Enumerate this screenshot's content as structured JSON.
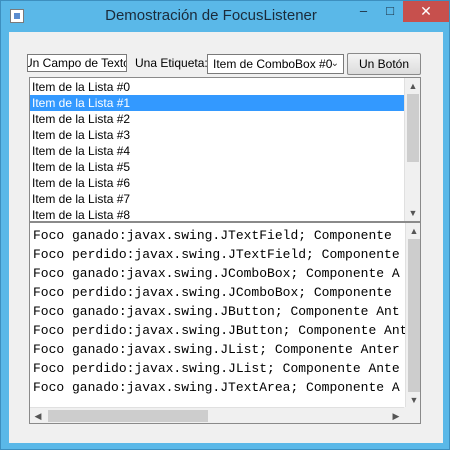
{
  "window": {
    "title": "Demostración de FocusListener",
    "controls": {
      "minimize": "–",
      "maximize": "□",
      "close": "✕"
    }
  },
  "top_row": {
    "textfield_value": "Un Campo de Texto",
    "label": "Una Etiqueta:",
    "combo_selected": "Item de ComboBox #0",
    "button_label": "Un Botón"
  },
  "list": {
    "items": [
      "Item de la Lista #0",
      "Item de la Lista #1",
      "Item de la Lista #2",
      "Item de la Lista #3",
      "Item de la Lista #4",
      "Item de la Lista #5",
      "Item de la Lista #6",
      "Item de la Lista #7",
      "Item de la Lista #8"
    ],
    "selected_index": 1
  },
  "textarea": {
    "lines": [
      "Foco ganado:javax.swing.JTextField; Componente",
      "Foco perdido:javax.swing.JTextField; Componente",
      "Foco ganado:javax.swing.JComboBox; Componente A",
      "Foco perdido:javax.swing.JComboBox; Componente",
      "Foco ganado:javax.swing.JButton; Componente Ant",
      "Foco perdido:javax.swing.JButton; Componente Ant",
      "Foco ganado:javax.swing.JList; Componente Anter",
      "Foco perdido:javax.swing.JList; Componente Ante",
      "Foco ganado:javax.swing.JTextArea; Componente A"
    ]
  },
  "colors": {
    "titlebar": "#5ab8e8",
    "selection": "#3399ff",
    "close_button": "#c7504d"
  }
}
